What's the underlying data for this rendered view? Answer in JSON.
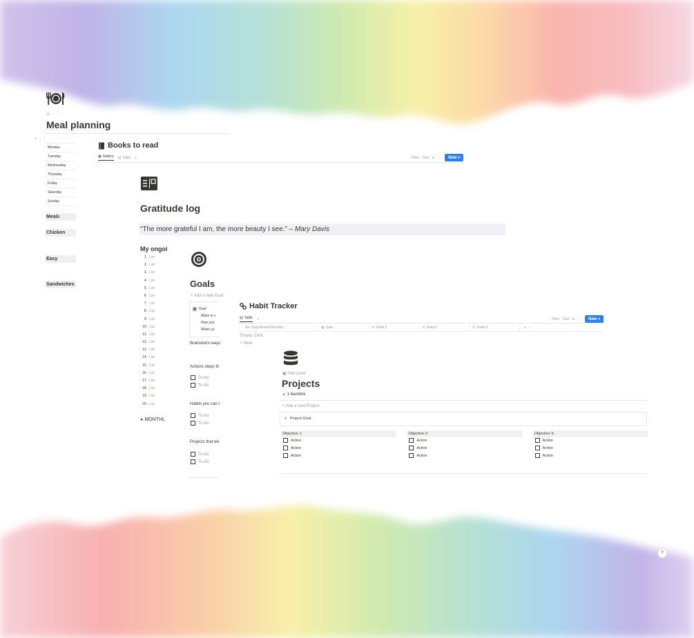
{
  "colors": {
    "accent": "#2f80ed",
    "text": "#37352f",
    "muted": "#9b9a97",
    "highlight": "#f1f0f5"
  },
  "meal": {
    "icon": "fork-plate-knife-icon",
    "title": "Meal planning",
    "days": [
      "Monday",
      "Tuesday",
      "Wednesday",
      "Thursday",
      "Friday",
      "Saturday",
      "Sunday"
    ],
    "tags": [
      "Meals",
      "Chicken",
      "Easy",
      "Sandwiches"
    ]
  },
  "books": {
    "title": "Books to read",
    "tabs": {
      "gallery": "Gallery",
      "table": "Table"
    },
    "toolbar": {
      "filter": "Filter",
      "sort": "Sort",
      "new": "New"
    }
  },
  "gratitude": {
    "title": "Gratitude log",
    "quote": "“The more grateful I am, the more beauty I see.” –",
    "author": "Mary Davis",
    "list_heading": "My ongoi",
    "list_label": "List",
    "list_numbers": [
      "1.",
      "2.",
      "3.",
      "4.",
      "5.",
      "6.",
      "7.",
      "8.",
      "9.",
      "10.",
      "11.",
      "12.",
      "13.",
      "14.",
      "15.",
      "16.",
      "17.",
      "18.",
      "19.",
      "20."
    ],
    "toggle": "MONTHL"
  },
  "goals": {
    "title": "Goals",
    "add": "Add a new Goal",
    "card": {
      "goal": "Goal",
      "line1": "Make is s",
      "line2": "How you",
      "line3": "When yo"
    },
    "brainstorm": "Brainstorm ways",
    "actions_heading": "Actions steps th",
    "habits_heading": "Habits you can t",
    "projects_heading": "Projects that wil",
    "todo": "To-do"
  },
  "habit": {
    "title": "Habit Tracker",
    "tab": "Table",
    "columns": [
      "Daily/Weekly/Monthly",
      "Date",
      "Habit 1",
      "Habit 2",
      "Habit 3"
    ],
    "empty": "Empty. Click",
    "new_row": "New",
    "toolbar": {
      "filter": "Filter",
      "sort": "Sort",
      "new": "New"
    }
  },
  "projects": {
    "title": "Projects",
    "add_cover": "Add cover",
    "backlink": "1 backlink",
    "add_project": "Add a new Project",
    "project_goal": "Project Goal:",
    "objectives": [
      "Objective 1:",
      "Objective 2:",
      "Objective 3:"
    ],
    "action": "Action"
  },
  "help": "?"
}
